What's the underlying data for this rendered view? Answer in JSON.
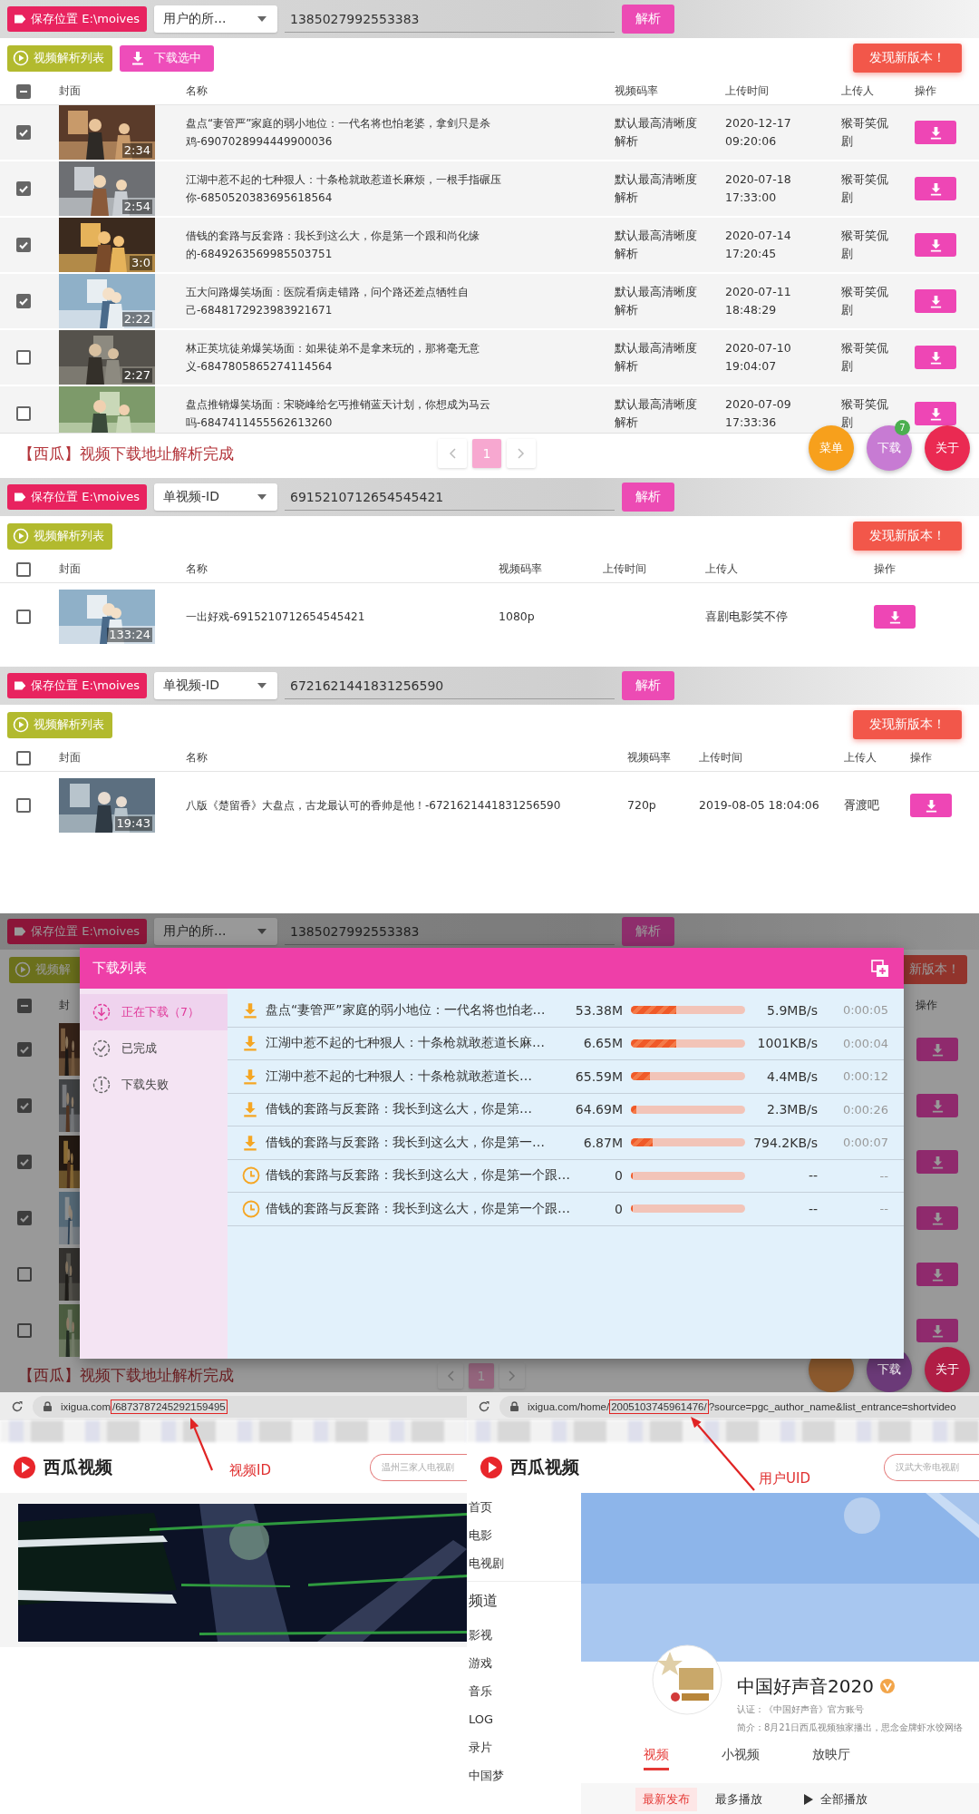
{
  "panels": [
    {
      "save_button": "保存位置 E:\\moives",
      "mode": "用户的所...",
      "query": "1385027992553383",
      "parse_button": "解析",
      "actions": [
        {
          "kind": "list",
          "label": "视频解析列表"
        },
        {
          "kind": "download",
          "label": "下载选中"
        }
      ],
      "update_button": "发现新版本！",
      "select_all_partial": true,
      "columns": [
        "封面",
        "名称",
        "视频码率",
        "上传时间",
        "上传人",
        "操作"
      ],
      "rows": [
        {
          "checked": true,
          "duration": "2:34",
          "name": "盘点“妻管严”家庭的弱小地位：一代名将也怕老婆，拿剑只是杀鸡-6907028994449900036",
          "bitrate": "默认最高清晰度解析",
          "uploaded": "2020-12-17 09:20:06",
          "uploader": "猴哥笑侃剧"
        },
        {
          "checked": true,
          "duration": "2:54",
          "name": "江湖中惹不起的七种狠人：十条枪就敢惹道长麻烦，一根手指碾压你-6850520383695618564",
          "bitrate": "默认最高清晰度解析",
          "uploaded": "2020-07-18 17:33:00",
          "uploader": "猴哥笑侃剧"
        },
        {
          "checked": true,
          "duration": "3:0",
          "name": "借钱的套路与反套路：我长到这么大，你是第一个跟和尚化缘的-6849263569985503751",
          "bitrate": "默认最高清晰度解析",
          "uploaded": "2020-07-14 17:20:45",
          "uploader": "猴哥笑侃剧"
        },
        {
          "checked": true,
          "duration": "2:22",
          "name": "五大问路爆笑场面：医院看病走错路，问个路还差点牺牲自己-6848172923983921671",
          "bitrate": "默认最高清晰度解析",
          "uploaded": "2020-07-11 18:48:29",
          "uploader": "猴哥笑侃剧"
        },
        {
          "checked": false,
          "duration": "2:27",
          "name": "林正英坑徒弟爆笑场面：如果徒弟不是拿来玩的，那将毫无意义-6847805865274114564",
          "bitrate": "默认最高清晰度解析",
          "uploaded": "2020-07-10 19:04:07",
          "uploader": "猴哥笑侃剧"
        },
        {
          "checked": false,
          "name": "盘点推销爆笑场面：宋晓峰给乞丐推销蓝天计划，你想成为马云吗-6847411455562613260",
          "bitrate": "默认最高清晰度解析",
          "uploaded": "2020-07-09 17:33:36",
          "uploader": "猴哥笑侃剧"
        }
      ],
      "status": "【西瓜】视频下载地址解析完成",
      "pages": [
        {
          "label": "1",
          "selected": true
        }
      ],
      "fabs": [
        {
          "label": "菜单",
          "color": "#f7a01c"
        },
        {
          "label": "下载",
          "color": "#c77bd3",
          "badge": "7"
        },
        {
          "label": "关于",
          "color": "#ea2a52"
        }
      ]
    },
    {
      "save_button": "保存位置 E:\\moives",
      "mode": "单视频-ID",
      "query": "6915210712654545421",
      "parse_button": "解析",
      "actions": [
        {
          "kind": "list",
          "label": "视频解析列表"
        }
      ],
      "update_button": "发现新版本！",
      "select_all_partial": false,
      "columns": [
        "封面",
        "名称",
        "视频码率",
        "上传时间",
        "上传人",
        "操作"
      ],
      "rows": [
        {
          "checked": false,
          "duration": "133:24",
          "name": "一出好戏-6915210712654545421",
          "bitrate": "1080p",
          "uploader": "喜剧电影笑不停"
        }
      ]
    },
    {
      "save_button": "保存位置 E:\\moives",
      "mode": "单视频-ID",
      "query": "6721621441831256590",
      "parse_button": "解析",
      "actions": [
        {
          "kind": "list",
          "label": "视频解析列表"
        }
      ],
      "update_button": "发现新版本！",
      "select_all_partial": false,
      "columns": [
        "封面",
        "名称",
        "视频码率",
        "上传时间",
        "上传人",
        "操作"
      ],
      "rows": [
        {
          "checked": false,
          "duration": "19:43",
          "name": "八版《楚留香》大盘点，古龙最认可的香帅是他！-6721621441831256590",
          "bitrate": "720p",
          "uploaded": "2019-08-05 18:04:06",
          "uploader": "胥渡吧"
        }
      ]
    }
  ],
  "dimmed_app": {
    "save_button": "保存位置 E:\\moives",
    "mode": "用户的所...",
    "query": "1385027992553383",
    "parse_button": "解析",
    "list_button": "视频解",
    "update_button": "新版本！",
    "select_all_partial": true,
    "cover_header": "封",
    "action_header": "操作",
    "rows": [
      {
        "checked": true
      },
      {
        "checked": true
      },
      {
        "checked": true
      },
      {
        "checked": true
      },
      {
        "checked": false
      },
      {
        "checked": false
      }
    ],
    "status": "【西瓜】视频下载地址解析完成",
    "pages": [
      {
        "label": "1",
        "selected": true
      }
    ],
    "fabs": [
      {
        "color": "#8c5a2e"
      },
      {
        "label": "下载",
        "color": "#6b3a78"
      },
      {
        "label": "关于",
        "color": "#b01d45"
      }
    ]
  },
  "download_dialog": {
    "title": "下载列表",
    "tabs": [
      {
        "kind": "downloading",
        "label": "正在下载（7）",
        "selected": true
      },
      {
        "kind": "done",
        "label": "已完成",
        "selected": false
      },
      {
        "kind": "failed",
        "label": "下载失败",
        "selected": false
      }
    ],
    "tasks": [
      {
        "kind": "downloading",
        "name": "盘点“妻管严”家庭的弱小地位：一代名将也怕老…",
        "size": "53.38M",
        "level": 0.4,
        "speed": "5.9MB/s",
        "eta": "0:00:05"
      },
      {
        "kind": "downloading",
        "name": "江湖中惹不起的七种狠人：十条枪就敢惹道长麻…",
        "size": "6.65M",
        "level": 0.4,
        "speed": "1001KB/s",
        "eta": "0:00:04"
      },
      {
        "kind": "downloading",
        "name": "江湖中惹不起的七种狠人：十条枪就敢惹道长…",
        "size": "65.59M",
        "level": 0.17,
        "speed": "4.4MB/s",
        "eta": "0:00:12"
      },
      {
        "kind": "downloading",
        "name": "借钱的套路与反套路：我长到这么大，你是第…",
        "size": "64.69M",
        "level": 0.05,
        "speed": "2.3MB/s",
        "eta": "0:00:26"
      },
      {
        "kind": "downloading",
        "name": "借钱的套路与反套路：我长到这么大，你是第一…",
        "size": "6.87M",
        "level": 0.19,
        "speed": "794.2KB/s",
        "eta": "0:00:07"
      },
      {
        "kind": "waiting",
        "name": "借钱的套路与反套路：我长到这么大，你是第一个跟…",
        "size": "0",
        "level": 0,
        "speed": "--",
        "eta": "--"
      },
      {
        "kind": "waiting",
        "name": "借钱的套路与反套路：我长到这么大，你是第一个跟…",
        "size": "0",
        "level": 0,
        "speed": "--",
        "eta": "--"
      }
    ]
  },
  "browsers": [
    {
      "kind": "video",
      "url_parts": [
        {
          "kind": "plain",
          "text": "ixigua.com"
        },
        {
          "kind": "highlight",
          "text": "/6873787245292159495"
        }
      ],
      "callout": "视频ID",
      "logo": "西瓜视频",
      "search_placeholder": "温州三家人电视剧"
    },
    {
      "kind": "profile",
      "url_parts": [
        {
          "kind": "plain",
          "text": "ixigua.com/home/"
        },
        {
          "kind": "highlight",
          "text": "2005103745961476/"
        },
        {
          "kind": "plain",
          "text": "?source=pgc_author_name&list_entrance=shortvideo"
        }
      ],
      "callout": "用户UID",
      "logo": "西瓜视频",
      "search_placeholder": "汉武大帝电视剧",
      "sidebar_links": [
        "首页",
        "电影",
        "电视剧"
      ],
      "sidebar_heading": "频道",
      "sidebar_channels": [
        "影视",
        "游戏",
        "音乐",
        "LOG",
        "录片",
        "中国梦"
      ],
      "channel": {
        "name": "中国好声音2020",
        "verified": true,
        "certification": "认证：《中国好声音》官方账号",
        "intro": "简介：8月21日西瓜视频独家播出，思念金牌虾水饺网络",
        "tabs": [
          {
            "label": "视频",
            "selected": true
          },
          {
            "label": "小视频",
            "selected": false
          },
          {
            "label": "放映厅",
            "selected": false
          }
        ],
        "sorts": [
          {
            "label": "最新发布",
            "selected": true
          },
          {
            "label": "最多播放",
            "selected": false
          }
        ],
        "play_all": "全部播放"
      }
    }
  ]
}
